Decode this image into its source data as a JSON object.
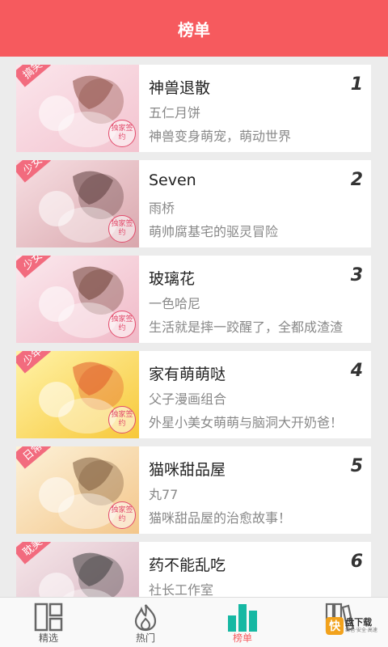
{
  "header": {
    "title": "榜单"
  },
  "items": [
    {
      "title": "神兽退散",
      "rank": "1",
      "author": "五仁月饼",
      "desc": "神兽变身萌宠，萌动世界",
      "genre": "搞笑",
      "stamp": "独家签约",
      "colors": [
        "#fbe6ec",
        "#f3c3cf",
        "#8a4a3f"
      ]
    },
    {
      "title": "Seven",
      "rank": "2",
      "author": "雨桥",
      "desc": "萌帅腐基宅的驱灵冒险",
      "genre": "少女",
      "stamp": "独家签约",
      "colors": [
        "#f7dfe3",
        "#d9a7ad",
        "#5b3a3a"
      ]
    },
    {
      "title": "玻璃花",
      "rank": "3",
      "author": "一色哈尼",
      "desc": "生活就是摔一跤醒了，全都成渣渣",
      "genre": "少女",
      "stamp": "独家签约",
      "colors": [
        "#fbe9ee",
        "#f0b9c7",
        "#6b3d32"
      ]
    },
    {
      "title": "家有萌萌哒",
      "rank": "4",
      "author": "父子漫画组合",
      "desc": "外星小美女萌萌与脑洞大开奶爸！",
      "genre": "少年",
      "stamp": "独家签约",
      "colors": [
        "#fff3a8",
        "#f7c83a",
        "#e05a2a"
      ]
    },
    {
      "title": "猫咪甜品屋",
      "rank": "5",
      "author": "丸77",
      "desc": "猫咪甜品屋的治愈故事！",
      "genre": "日常",
      "stamp": "独家签约",
      "colors": [
        "#fdf2d9",
        "#f3c68a",
        "#7b5a3a"
      ]
    },
    {
      "title": "药不能乱吃",
      "rank": "6",
      "author": "社长工作室",
      "desc": "",
      "genre": "耽美",
      "stamp": "",
      "colors": [
        "#f6e7ea",
        "#d7b3c0",
        "#3a3a3a"
      ]
    }
  ],
  "tabs": [
    {
      "label": "精选",
      "icon": "grid-icon",
      "active": false
    },
    {
      "label": "热门",
      "icon": "flame-icon",
      "active": false
    },
    {
      "label": "榜单",
      "icon": "bar-chart-icon",
      "active": true
    },
    {
      "label": "",
      "icon": "bookshelf-icon",
      "active": false
    }
  ],
  "watermark": {
    "mark": "快",
    "name": "盘下载",
    "sub": "绿色·安全·高速"
  },
  "theme": {
    "accent": "#f65a5e"
  }
}
